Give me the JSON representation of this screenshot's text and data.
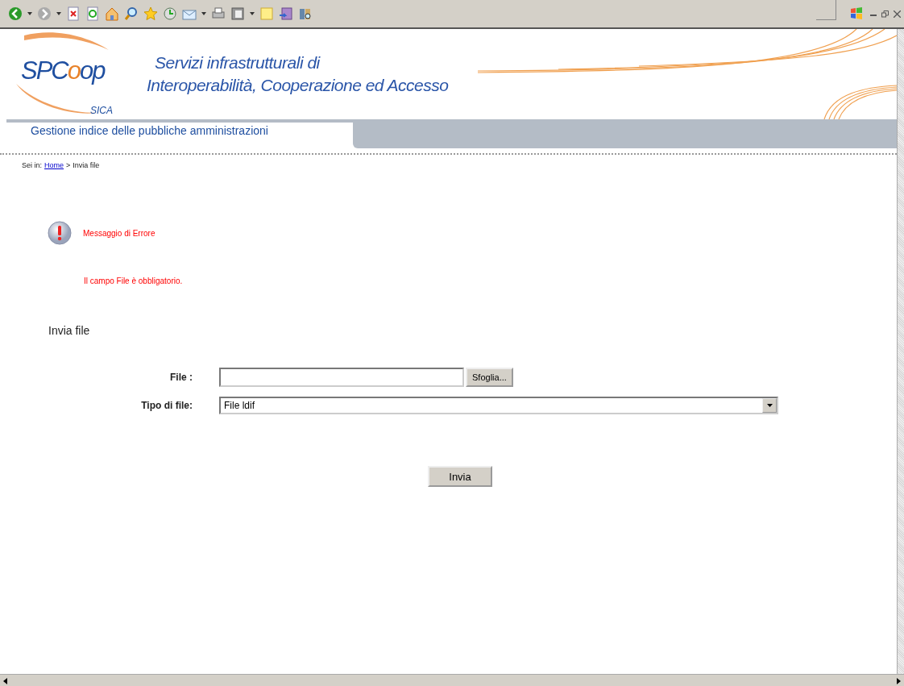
{
  "logo": {
    "segments": [
      {
        "text": "SPC",
        "color": "#1f4fa0"
      },
      {
        "text": "o",
        "color": "#e8822a"
      },
      {
        "text": "op",
        "color": "#1f4fa0"
      }
    ],
    "subtitle": "SICA"
  },
  "banner": {
    "lines": [
      "Servizi infrastrutturali di",
      "Interoperabilità, Cooperazione ed Accesso"
    ]
  },
  "nav": {
    "tab": "Gestione indice delle pubbliche amministrazioni"
  },
  "breadcrumb": {
    "prefix": "Sei in:",
    "link": "Home",
    "separator": ">",
    "current": "Invia file"
  },
  "error": {
    "title": "Messaggio di Errore",
    "message": "Il campo File è obbligatorio."
  },
  "form": {
    "heading": "Invia file",
    "file_label": "File :",
    "browse_button": "Sfoglia...",
    "type_label": "Tipo di file:",
    "type_value": "File ldif",
    "submit": "Invia"
  }
}
